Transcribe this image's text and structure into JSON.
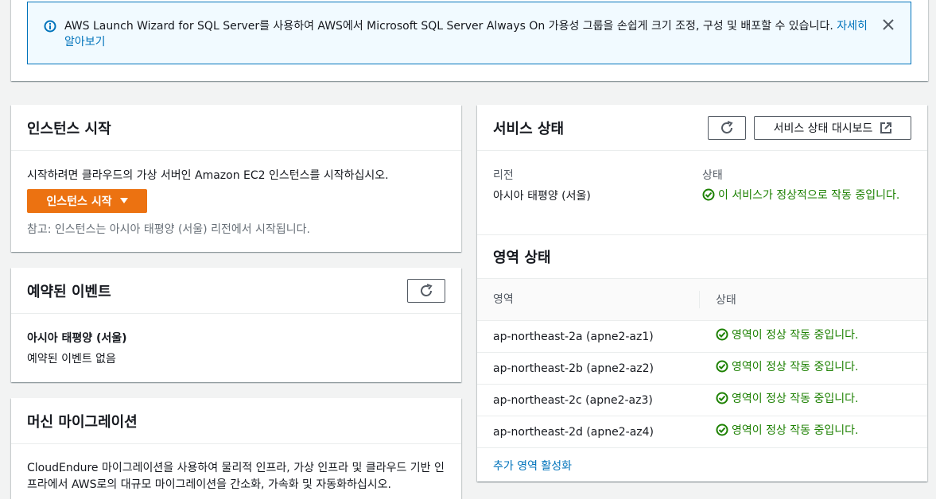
{
  "banner": {
    "text": "AWS Launch Wizard for SQL Server를 사용하여 AWS에서 Microsoft SQL Server Always On 가용성 그룹을 손쉽게 크기 조정, 구성 및 배포할 수 있습니다. ",
    "link": "자세히 알아보기"
  },
  "launch": {
    "title": "인스턴스 시작",
    "description": "시작하려면 클라우드의 가상 서버인 Amazon EC2 인스턴스를 시작하십시오.",
    "button": "인스턴스 시작",
    "note": "참고: 인스턴스는 아시아 태평양 (서울) 리전에서 시작됩니다."
  },
  "events": {
    "title": "예약된 이벤트",
    "region": "아시아 태평양 (서울)",
    "empty": "예약된 이벤트 없음"
  },
  "migration": {
    "title": "머신 마이그레이션",
    "text": "CloudEndure 마이그레이션을 사용하여 물리적 인프라, 가상 인프라 및 클라우드 기반 인프라에서 AWS로의 대규모 마이그레이션을 간소화, 가속화 및 자동화하십시오."
  },
  "health": {
    "title": "서비스 상태",
    "dashboard_button": "서비스 상태 대시보드",
    "region_label": "리전",
    "region_value": "아시아 태평양 (서울)",
    "status_label": "상태",
    "status_value": "이 서비스가 정상적으로 작동 중입니다.",
    "zone_title": "영역 상태",
    "zone_col": "영역",
    "status_col": "상태",
    "zones": [
      {
        "name": "ap-northeast-2a (apne2-az1)",
        "status": "영역이 정상 작동 중입니다."
      },
      {
        "name": "ap-northeast-2b (apne2-az2)",
        "status": "영역이 정상 작동 중입니다."
      },
      {
        "name": "ap-northeast-2c (apne2-az3)",
        "status": "영역이 정상 작동 중입니다."
      },
      {
        "name": "ap-northeast-2d (apne2-az4)",
        "status": "영역이 정상 작동 중입니다."
      }
    ],
    "more_link": "추가 영역 활성화"
  },
  "colors": {
    "accent": "#ec7211",
    "link": "#0073bb",
    "success": "#1d8102",
    "info_border": "#0073bb"
  },
  "icons": [
    "info-icon",
    "close-icon",
    "caret-down-icon",
    "refresh-icon",
    "external-link-icon",
    "check-circle-icon"
  ]
}
